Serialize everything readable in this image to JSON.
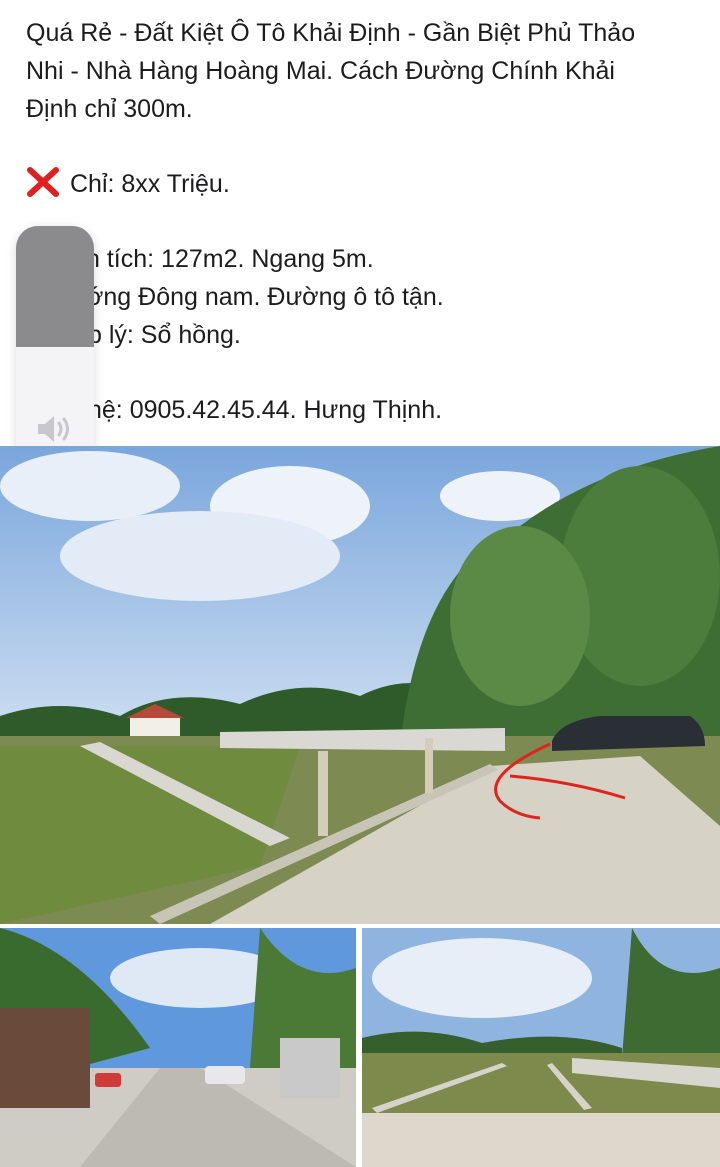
{
  "post": {
    "title_line1": "Quá Rẻ - Đất Kiệt Ô Tô Khải Định - Gần Biệt Phủ Thảo",
    "title_line2": "Nhi - Nhà Hàng Hoàng Mai. Cách Đường Chính Khải",
    "title_line3": "Định chỉ 300m.",
    "price": "Chỉ: 8xx Triệu.",
    "area": "n tích: 127m2. Ngang 5m.",
    "direction": "ớng Đông nam. Đường ô tô tận.",
    "legal": "p lý: Sổ hồng.",
    "contact": "hệ: 0905.42.45.44. Hưng Thịnh."
  },
  "icons": {
    "price_marker": "red-cross-mark-icon",
    "volume": "speaker-icon"
  },
  "volume_level": 0.5,
  "colors": {
    "text": "#1c1c1e",
    "cross_mark": "#e02020",
    "hud_background": "#f4f4f6",
    "hud_fill": "#8b8b8e"
  }
}
